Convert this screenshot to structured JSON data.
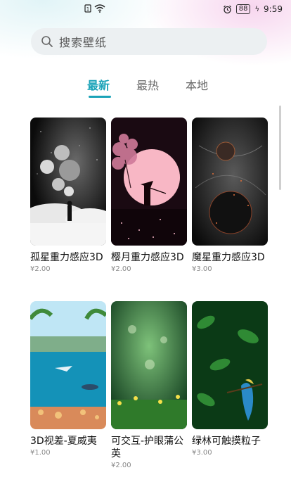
{
  "status_bar": {
    "battery": "88",
    "time": "9:59"
  },
  "search": {
    "placeholder": "搜索壁纸"
  },
  "tabs": [
    "最新",
    "最热",
    "本地"
  ],
  "wallpapers": [
    {
      "name": "孤星重力感应3D",
      "price": "¥2.00"
    },
    {
      "name": "樱月重力感应3D",
      "price": "¥2.00"
    },
    {
      "name": "魔星重力感应3D",
      "price": "¥3.00"
    },
    {
      "name": "3D视差-夏威夷",
      "price": "¥1.00"
    },
    {
      "name": "可交互-护眼蒲公英",
      "price": "¥2.00"
    },
    {
      "name": "绿林可触摸粒子",
      "price": "¥3.00"
    }
  ],
  "icons": {
    "search": "search-icon",
    "alarm": "alarm-icon",
    "wifi": "wifi-icon",
    "sim": "sim-icon"
  }
}
